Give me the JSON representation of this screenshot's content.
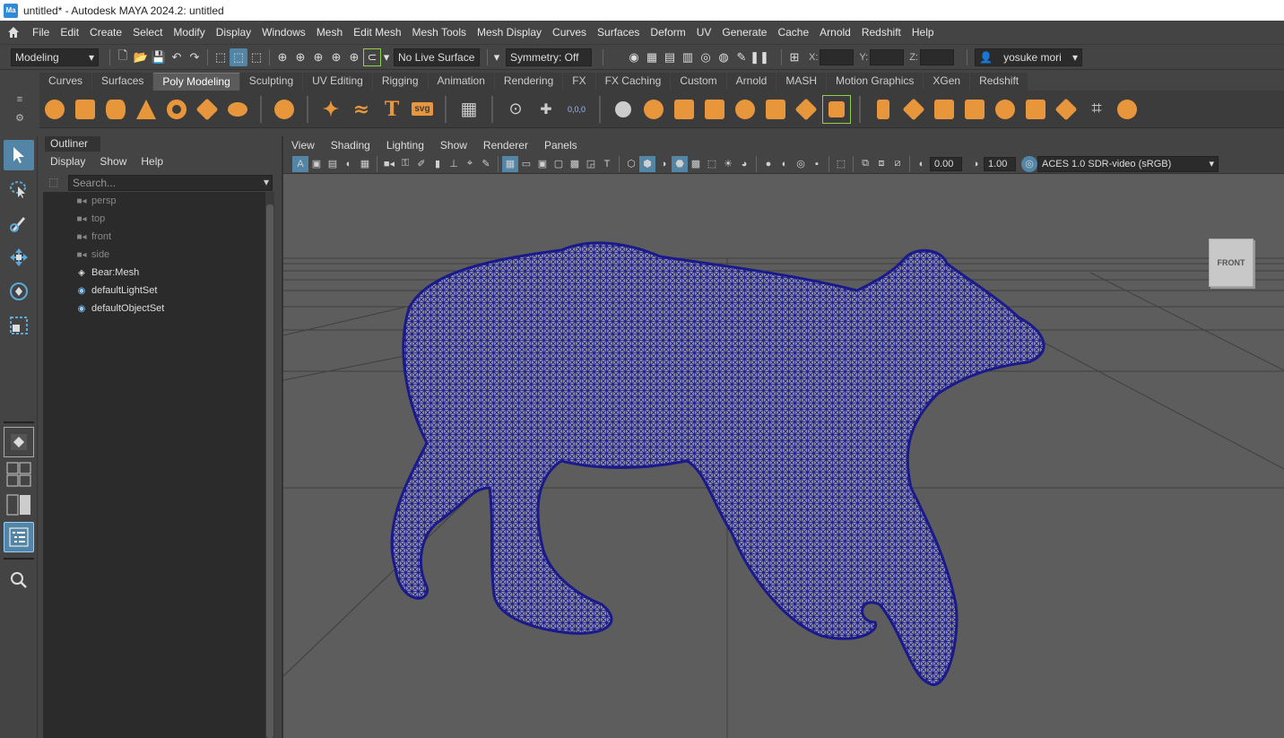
{
  "window": {
    "title": "untitled* - Autodesk MAYA 2024.2: untitled",
    "logo": "Ma"
  },
  "menubar": [
    "File",
    "Edit",
    "Create",
    "Select",
    "Modify",
    "Display",
    "Windows",
    "Mesh",
    "Edit Mesh",
    "Mesh Tools",
    "Mesh Display",
    "Curves",
    "Surfaces",
    "Deform",
    "UV",
    "Generate",
    "Cache",
    "Arnold",
    "Redshift",
    "Help"
  ],
  "statusline": {
    "menuset": "Modeling",
    "live_surface": "No Live Surface",
    "symmetry": "Symmetry: Off",
    "x_label": "X:",
    "y_label": "Y:",
    "z_label": "Z:",
    "user": "yosuke mori"
  },
  "shelf_tabs": [
    "Curves",
    "Surfaces",
    "Poly Modeling",
    "Sculpting",
    "UV Editing",
    "Rigging",
    "Animation",
    "Rendering",
    "FX",
    "FX Caching",
    "Custom",
    "Arnold",
    "MASH",
    "Motion Graphics",
    "XGen",
    "Redshift"
  ],
  "shelf_active": "Poly Modeling",
  "shelf_text_icons": {
    "text_tool": "T",
    "svg_tool": "svg",
    "uv_label": "0,0,0"
  },
  "outliner": {
    "tab": "Outliner",
    "menu": [
      "Display",
      "Show",
      "Help"
    ],
    "search_placeholder": "Search...",
    "items": [
      {
        "label": "persp",
        "icon": "camera-icon",
        "dim": true
      },
      {
        "label": "top",
        "icon": "camera-icon",
        "dim": true
      },
      {
        "label": "front",
        "icon": "camera-icon",
        "dim": true
      },
      {
        "label": "side",
        "icon": "camera-icon",
        "dim": true
      },
      {
        "label": "Bear:Mesh",
        "icon": "mesh-icon",
        "dim": false
      },
      {
        "label": "defaultLightSet",
        "icon": "set-icon",
        "dim": false
      },
      {
        "label": "defaultObjectSet",
        "icon": "set-icon",
        "dim": false
      }
    ]
  },
  "viewport": {
    "menu": [
      "View",
      "Shading",
      "Lighting",
      "Show",
      "Renderer",
      "Panels"
    ],
    "exposure": "0.00",
    "gamma": "1.00",
    "color_space": "ACES 1.0 SDR-video (sRGB)",
    "view_cube": "FRONT"
  },
  "colors": {
    "accent": "#5285a6",
    "shelf_icon": "#e8963b",
    "wireframe": "#1a1a8a",
    "viewport_bg": "#5d5d5d"
  }
}
